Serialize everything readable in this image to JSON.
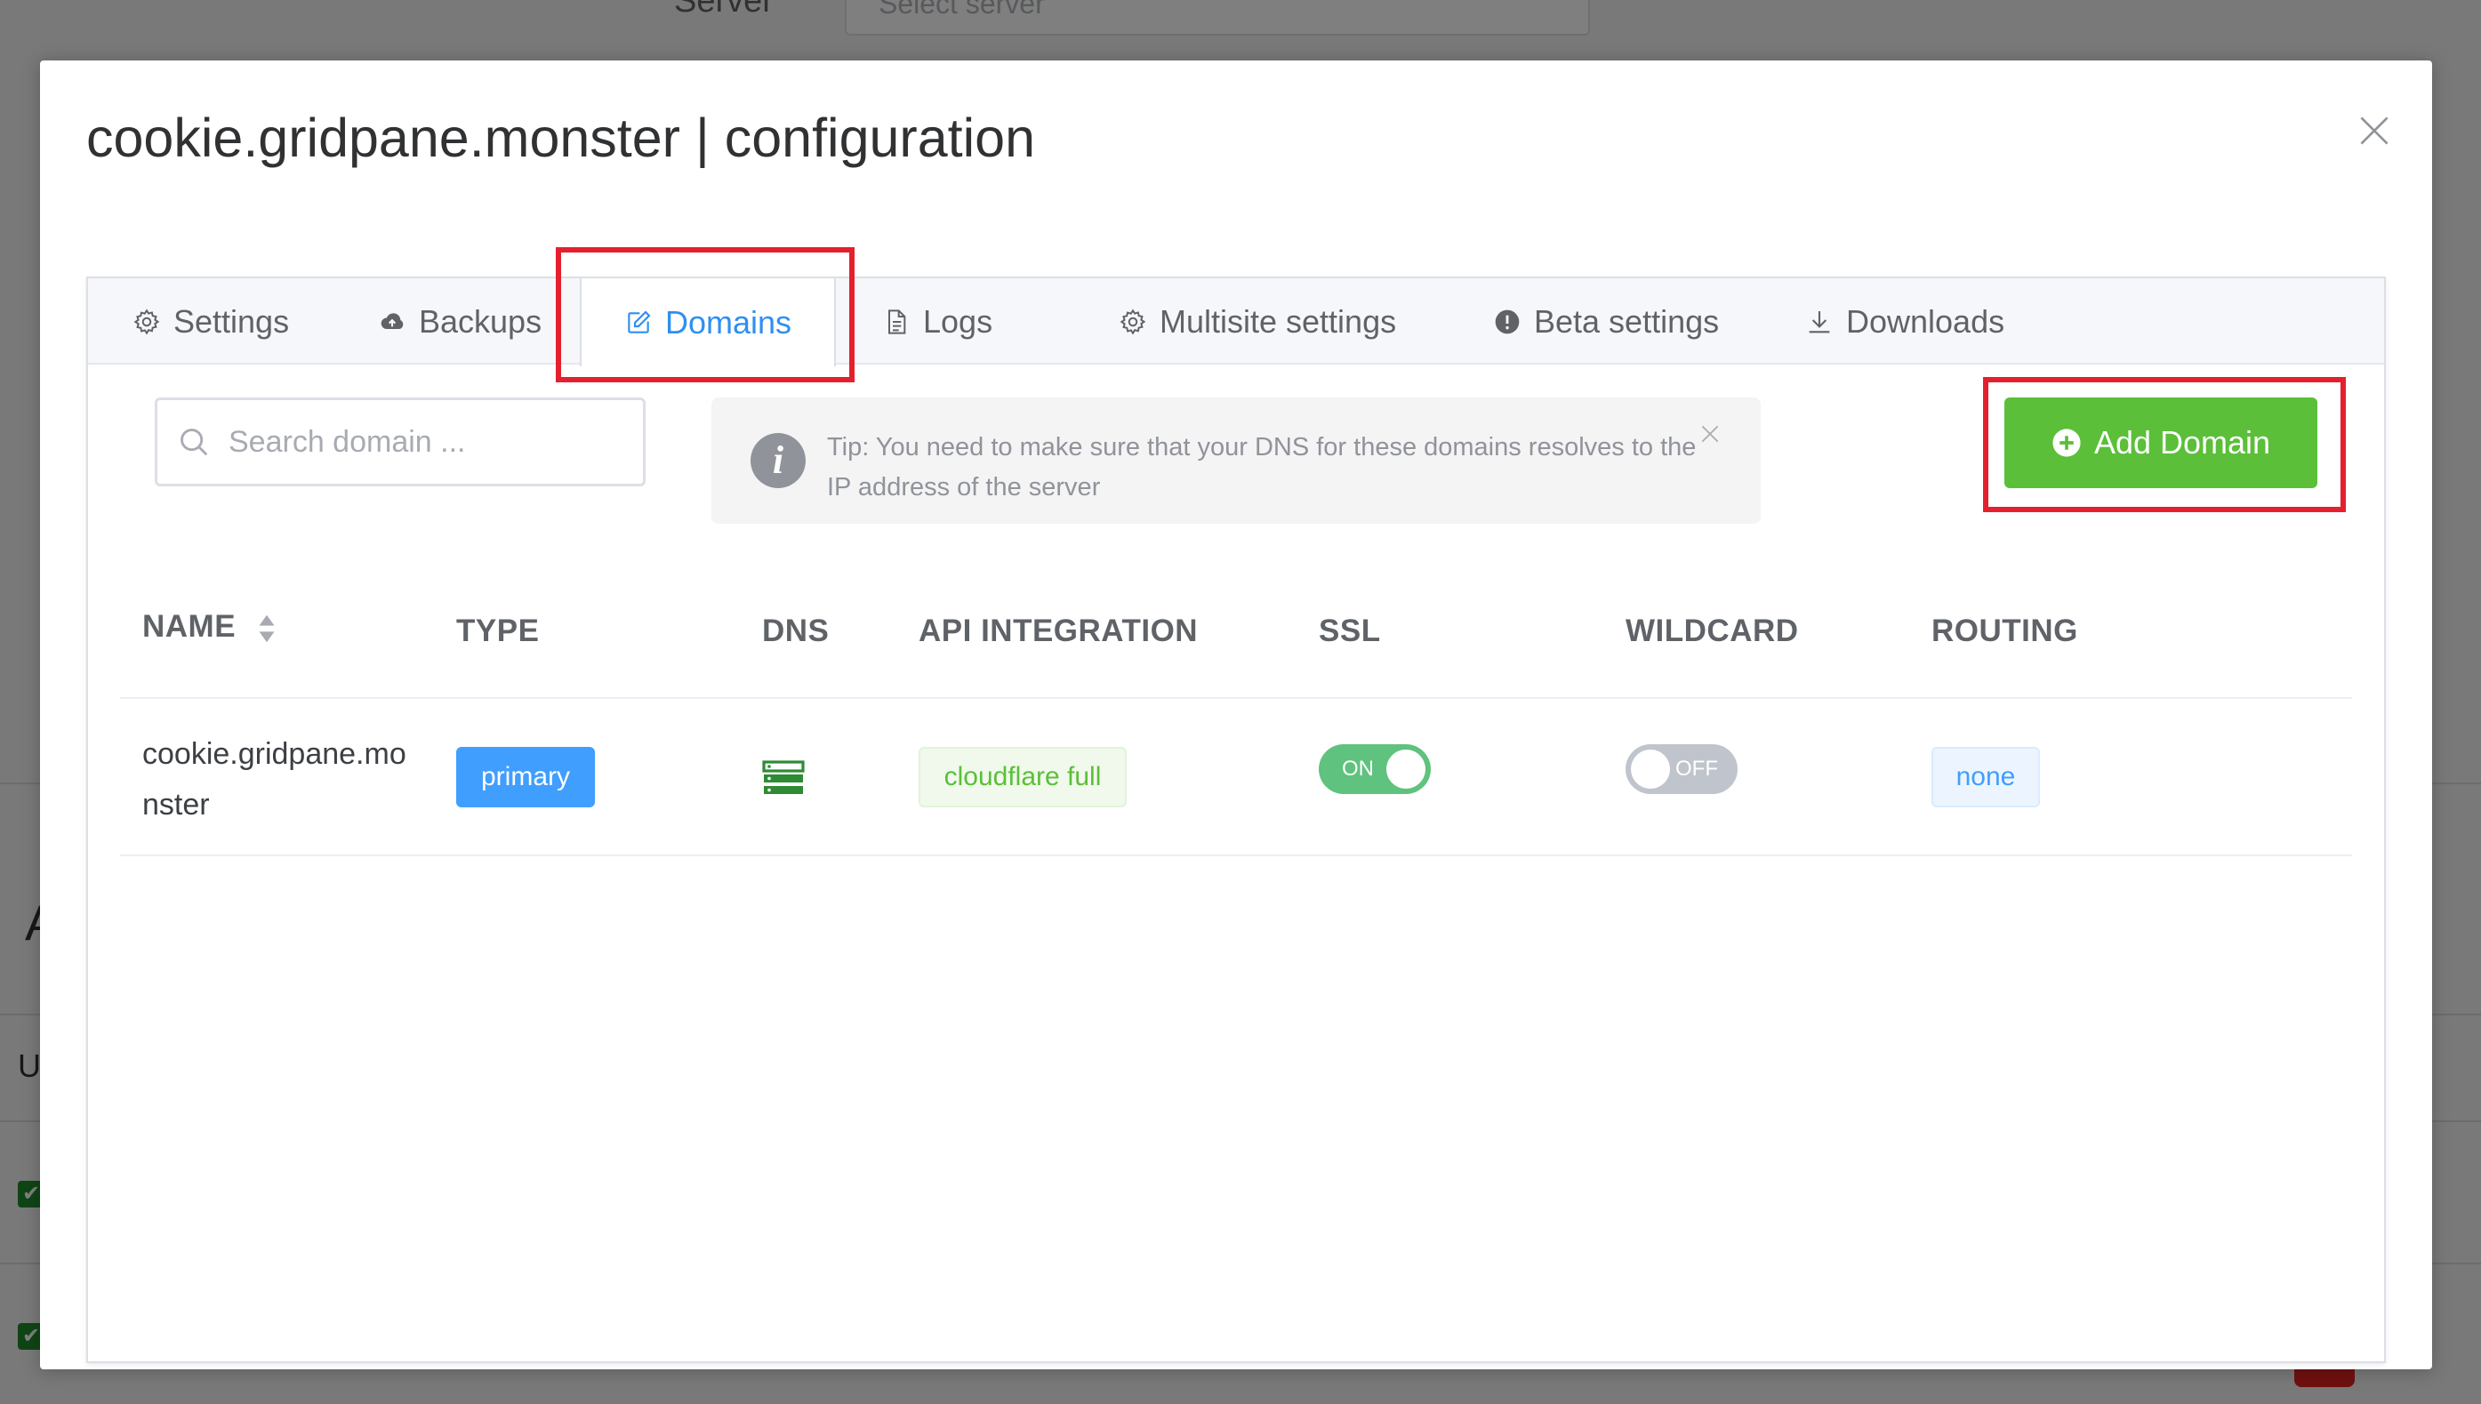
{
  "background": {
    "server_label": "Server",
    "server_select_placeholder": "Select server",
    "partial_letter_a": "A",
    "partial_letter_u": "U"
  },
  "modal": {
    "title": "cookie.gridpane.monster | configuration",
    "close_icon": "close-icon"
  },
  "tabs": [
    {
      "label": "Settings",
      "icon": "gear-icon",
      "active": false
    },
    {
      "label": "Backups",
      "icon": "cloud-upload-icon",
      "active": false
    },
    {
      "label": "Domains",
      "icon": "edit-icon",
      "active": true
    },
    {
      "label": "Logs",
      "icon": "document-icon",
      "active": false
    },
    {
      "label": "Multisite settings",
      "icon": "gear-icon",
      "active": false
    },
    {
      "label": "Beta settings",
      "icon": "warning-circle-icon",
      "active": false
    },
    {
      "label": "Downloads",
      "icon": "download-icon",
      "active": false
    }
  ],
  "search": {
    "placeholder": "Search domain ...",
    "value": ""
  },
  "tip": {
    "text": "Tip: You need to make sure that your DNS for these domains resolves to the IP address of the server"
  },
  "add_domain": {
    "label": "Add Domain"
  },
  "table": {
    "columns": [
      "NAME",
      "TYPE",
      "DNS",
      "API INTEGRATION",
      "SSL",
      "WILDCARD",
      "ROUTING"
    ],
    "rows": [
      {
        "name": "cookie.gridpane.monster",
        "type": "primary",
        "dns_icon": "server-icon",
        "api_integration": "cloudflare full",
        "ssl": "ON",
        "wildcard": "OFF",
        "routing": "none"
      }
    ]
  },
  "colors": {
    "accent": "#409eff",
    "success": "#5bbf39",
    "switch_on": "#5fc27e",
    "switch_off": "#c0c4cc",
    "highlight": "#e5202e"
  }
}
